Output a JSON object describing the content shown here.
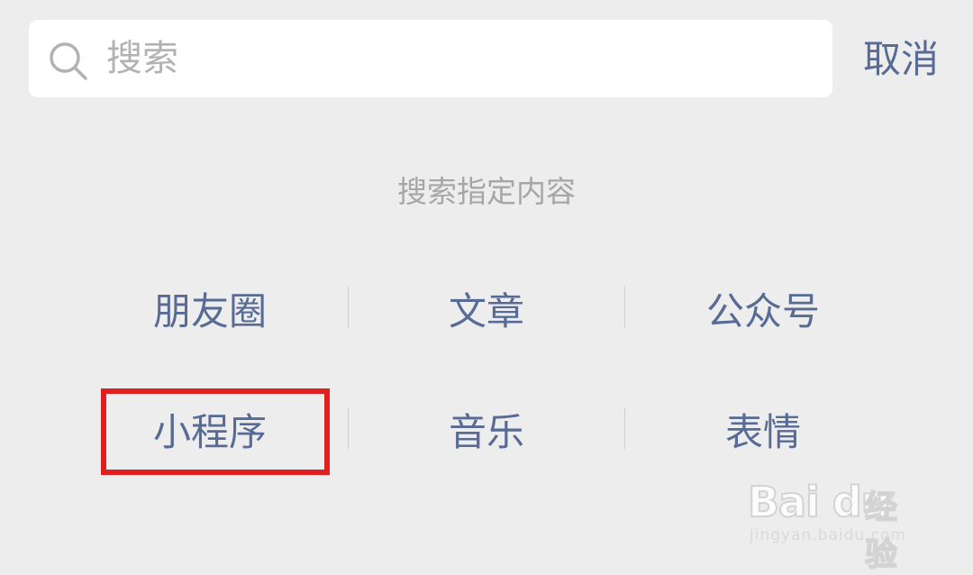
{
  "search": {
    "placeholder": "搜索",
    "cancel_label": "取消"
  },
  "hint": "搜索指定内容",
  "categories": [
    {
      "label": "朋友圈"
    },
    {
      "label": "文章"
    },
    {
      "label": "公众号"
    },
    {
      "label": "小程序"
    },
    {
      "label": "音乐"
    },
    {
      "label": "表情"
    }
  ],
  "highlighted_category": "小程序",
  "watermark": {
    "logo": "Bai du",
    "text": "经验",
    "url": "jingyan.baidu.com"
  },
  "colors": {
    "background": "#ededed",
    "link": "#576b95",
    "hint": "#a6a6a6",
    "highlight": "#e02020"
  }
}
